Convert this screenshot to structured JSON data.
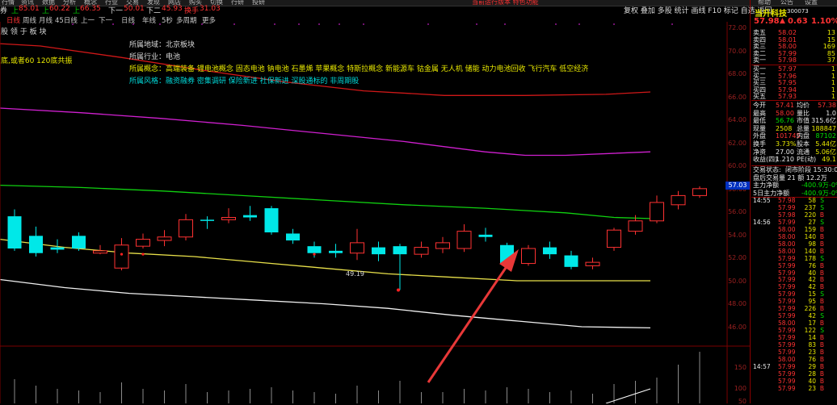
{
  "menubar": {
    "items": [
      "行情",
      "资讯",
      "数据",
      "分析",
      "概念",
      "行业",
      "交易",
      "发现",
      "网店",
      "购买",
      "切换",
      "行研",
      "投研"
    ],
    "right_items": [
      "帮助",
      "公告",
      "设置"
    ],
    "center_note": "当前运行版本 特色功能"
  },
  "toolbar": {
    "left_fragment": "券",
    "label_a": "上",
    "value_a": "85.01",
    "label_b": "上",
    "value_b": "60.22",
    "label_c": "上",
    "value_c": "66.35",
    "label_d": "下一",
    "value_d": "50.01",
    "label_e": "下二",
    "value_e": "45.93",
    "label_f": "换手",
    "value_f": "31.03",
    "right_tools": "复权 叠加 多股 统计 画线 F10 标记 自选 返回"
  },
  "period_bar": {
    "items": [
      "日线",
      "周线",
      "月线",
      "45日线",
      "上一",
      "下一",
      "日线",
      "年线",
      "5秒",
      "多周期",
      "更多"
    ],
    "active_index": 0
  },
  "info": {
    "board_label": "股 领 于 板 块",
    "indicator_label": "底,或者60 120底共振",
    "region": "所属地域：北京板块",
    "industry": "所属行业：电池",
    "concepts": "所属概念：高端装备 锂电池概念 固态电池 钠电池 石墨烯 苹果概念 特斯拉概念 新能源车 钴金属 无人机 储能 动力电池回收 飞行汽车 低空经济",
    "styles": "所属风格：融资融券 密集调研 保险新进 社保新进 深股通标的 非周期股"
  },
  "price_axis": {
    "labels": [
      "72.00",
      "70.00",
      "68.00",
      "66.00",
      "64.00",
      "62.00",
      "60.00",
      "58.00",
      "56.00",
      "54.00",
      "52.00",
      "50.00",
      "48.00",
      "46.00"
    ],
    "current_tag": "57.03"
  },
  "volume_axis": {
    "labels": [
      "150",
      "100",
      "50"
    ]
  },
  "low_marker": "49.19",
  "stock": {
    "name": "当升科技",
    "code": "300073",
    "price": "57.98",
    "change_arrow": "▲",
    "change": "0.63",
    "change_pct": "1.10%"
  },
  "order_book": {
    "asks": [
      {
        "label": "卖五",
        "price": "58.02",
        "vol": "13"
      },
      {
        "label": "卖四",
        "price": "58.01",
        "vol": "15"
      },
      {
        "label": "卖三",
        "price": "58.00",
        "vol": "169"
      },
      {
        "label": "卖二",
        "price": "57.99",
        "vol": "85"
      },
      {
        "label": "卖一",
        "price": "57.98",
        "vol": "37"
      }
    ],
    "bids": [
      {
        "label": "买一",
        "price": "57.97",
        "vol": "1"
      },
      {
        "label": "买二",
        "price": "57.96",
        "vol": "1"
      },
      {
        "label": "买三",
        "price": "57.95",
        "vol": "1"
      },
      {
        "label": "买四",
        "price": "57.94",
        "vol": "1"
      },
      {
        "label": "买五",
        "price": "57.93",
        "vol": "1"
      }
    ]
  },
  "stats": [
    {
      "l1": "今开",
      "v1": "57.41",
      "l2": "均价",
      "v2": "57.38"
    },
    {
      "l1": "最高",
      "v1": "58.00",
      "l2": "量比",
      "v2": "1.0"
    },
    {
      "l1": "最低",
      "v1": "56.76",
      "l2": "市值",
      "v2": "315.6亿"
    },
    {
      "l1": "现量",
      "v1": "2508",
      "l2": "总量",
      "v2": "188847"
    },
    {
      "l1": "外盘",
      "v1": "101745",
      "l2": "内盘",
      "v2": "87102"
    },
    {
      "l1": "换手",
      "v1": "3.73%",
      "l2": "股本",
      "v2": "5.44亿"
    },
    {
      "l1": "净资",
      "v1": "27.00",
      "l2": "流通",
      "v2": "5.06亿"
    },
    {
      "l1": "收益(四)",
      "v1": "1.210",
      "l2": "PE(动)",
      "v2": "49.1"
    }
  ],
  "trade_status": {
    "line1_label": "交易状态:",
    "line1_value": "闭市阶段 15:30:00",
    "line2": "盘后交易量 21 额 12.2万"
  },
  "main_flow": {
    "row1_label": "主力净额",
    "row1_value": "-400.9万",
    "row1_pct": "-0%",
    "row2_label": "5日主力净额",
    "row2_value": "-400.9万",
    "row2_pct": "-0%"
  },
  "ticks": {
    "time1": "14:55",
    "time2": "14:56",
    "time3": "14:57",
    "rows": [
      {
        "p": "57.98",
        "v": "58",
        "f": "S"
      },
      {
        "p": "57.99",
        "v": "237",
        "f": "S"
      },
      {
        "p": "57.98",
        "v": "220",
        "f": "B"
      },
      {
        "p": "57.99",
        "v": "27",
        "f": "S"
      },
      {
        "p": "58.00",
        "v": "159",
        "f": "B"
      },
      {
        "p": "58.00",
        "v": "140",
        "f": "B"
      },
      {
        "p": "58.00",
        "v": "98",
        "f": "B"
      },
      {
        "p": "58.00",
        "v": "140",
        "f": "B"
      },
      {
        "p": "57.99",
        "v": "178",
        "f": "S"
      },
      {
        "p": "57.99",
        "v": "76",
        "f": "B"
      },
      {
        "p": "57.99",
        "v": "40",
        "f": "B"
      },
      {
        "p": "57.99",
        "v": "42",
        "f": "B"
      },
      {
        "p": "57.99",
        "v": "42",
        "f": "B"
      },
      {
        "p": "57.99",
        "v": "15",
        "f": "S"
      },
      {
        "p": "57.99",
        "v": "95",
        "f": "B"
      },
      {
        "p": "57.99",
        "v": "226",
        "f": "B"
      },
      {
        "p": "57.99",
        "v": "42",
        "f": "S"
      },
      {
        "p": "58.00",
        "v": "17",
        "f": "B"
      },
      {
        "p": "57.99",
        "v": "122",
        "f": "S"
      },
      {
        "p": "57.99",
        "v": "14",
        "f": "B"
      },
      {
        "p": "57.99",
        "v": "83",
        "f": "B"
      },
      {
        "p": "57.99",
        "v": "23",
        "f": "B"
      },
      {
        "p": "58.00",
        "v": "76",
        "f": "B"
      },
      {
        "p": "57.99",
        "v": "29",
        "f": "B"
      },
      {
        "p": "57.99",
        "v": "28",
        "f": "B"
      },
      {
        "p": "57.99",
        "v": "40",
        "f": "B"
      },
      {
        "p": "57.99",
        "v": "23",
        "f": "B"
      }
    ]
  },
  "colors": {
    "up": "#ff3232",
    "down": "#00e8e8",
    "ma_yellow": "#e8e04a",
    "ma_white": "#f0f0f0",
    "ma_green": "#10d010",
    "ma_magenta": "#d020d0",
    "ma_red": "#d01818",
    "arrow": "#e83838"
  },
  "candles": [
    {
      "o": 55.6,
      "c": 52.8,
      "h": 56.2,
      "l": 52.6
    },
    {
      "o": 53.9,
      "c": 52.4,
      "h": 54.7,
      "l": 52.1
    },
    {
      "o": 52.9,
      "c": 52.7,
      "h": 53.6,
      "l": 52.4
    },
    {
      "o": 53.9,
      "c": 52.8,
      "h": 54.2,
      "l": 52.6
    },
    {
      "o": 52.4,
      "c": 52.6,
      "h": 53.1,
      "l": 52.3
    },
    {
      "o": 51.1,
      "c": 53.1,
      "h": 53.7,
      "l": 50.9
    },
    {
      "o": 53.0,
      "c": 53.6,
      "h": 54.1,
      "l": 52.8
    },
    {
      "o": 53.5,
      "c": 53.8,
      "h": 54.4,
      "l": 53.0
    },
    {
      "o": 53.8,
      "c": 55.3,
      "h": 55.8,
      "l": 53.5
    },
    {
      "o": 55.3,
      "c": 55.2,
      "h": 55.6,
      "l": 54.5
    },
    {
      "o": 55.3,
      "c": 55.5,
      "h": 56.3,
      "l": 55.0
    },
    {
      "o": 55.7,
      "c": 55.5,
      "h": 56.5,
      "l": 55.2
    },
    {
      "o": 56.3,
      "c": 54.2,
      "h": 56.5,
      "l": 54.0
    },
    {
      "o": 54.1,
      "c": 53.5,
      "h": 54.5,
      "l": 53.2
    },
    {
      "o": 53.0,
      "c": 52.4,
      "h": 53.4,
      "l": 52.0
    },
    {
      "o": 52.6,
      "c": 52.4,
      "h": 53.2,
      "l": 52.0
    },
    {
      "o": 52.4,
      "c": 53.3,
      "h": 54.5,
      "l": 51.8
    },
    {
      "o": 52.9,
      "c": 52.3,
      "h": 53.4,
      "l": 51.7
    },
    {
      "o": 53.0,
      "c": 52.3,
      "h": 53.2,
      "l": 49.2
    },
    {
      "o": 52.3,
      "c": 52.9,
      "h": 53.4,
      "l": 52.0
    },
    {
      "o": 52.8,
      "c": 53.3,
      "h": 53.8,
      "l": 52.4
    },
    {
      "o": 52.8,
      "c": 54.3,
      "h": 54.9,
      "l": 52.5
    },
    {
      "o": 54.0,
      "c": 53.8,
      "h": 54.6,
      "l": 53.4
    },
    {
      "o": 53.1,
      "c": 51.5,
      "h": 53.3,
      "l": 51.3
    },
    {
      "o": 51.5,
      "c": 52.8,
      "h": 53.1,
      "l": 51.3
    },
    {
      "o": 52.9,
      "c": 52.3,
      "h": 53.4,
      "l": 51.9
    },
    {
      "o": 52.2,
      "c": 51.2,
      "h": 52.6,
      "l": 51.0
    },
    {
      "o": 51.3,
      "c": 51.6,
      "h": 52.0,
      "l": 51.0
    },
    {
      "o": 52.9,
      "c": 54.4,
      "h": 54.6,
      "l": 52.6
    },
    {
      "o": 54.3,
      "c": 55.2,
      "h": 55.7,
      "l": 54.0
    },
    {
      "o": 55.2,
      "c": 56.8,
      "h": 57.4,
      "l": 55.0
    },
    {
      "o": 56.6,
      "c": 57.4,
      "h": 57.8,
      "l": 56.2
    },
    {
      "o": 57.4,
      "c": 58.0,
      "h": 58.2,
      "l": 57.2
    }
  ],
  "volumes": [
    30,
    22,
    18,
    16,
    14,
    26,
    18,
    16,
    24,
    14,
    16,
    18,
    20,
    16,
    14,
    12,
    22,
    16,
    28,
    14,
    14,
    18,
    16,
    20,
    18,
    14,
    16,
    12,
    24,
    28,
    32,
    48,
    64
  ],
  "ma_lines": {
    "red": [
      [
        0,
        70.6
      ],
      [
        50,
        70.4
      ],
      [
        150,
        69.4
      ],
      [
        250,
        68.3
      ],
      [
        350,
        67.3
      ],
      [
        450,
        66.5
      ],
      [
        550,
        66.1
      ],
      [
        650,
        66.1
      ],
      [
        750,
        66.2
      ],
      [
        805,
        66.4
      ]
    ],
    "magenta": [
      [
        0,
        65.0
      ],
      [
        100,
        64.6
      ],
      [
        200,
        64.1
      ],
      [
        300,
        63.5
      ],
      [
        400,
        62.8
      ],
      [
        500,
        62.1
      ],
      [
        600,
        61.2
      ],
      [
        650,
        60.9
      ],
      [
        700,
        60.9
      ],
      [
        805,
        61.2
      ]
    ],
    "green": [
      [
        0,
        58.3
      ],
      [
        100,
        58.1
      ],
      [
        200,
        57.8
      ],
      [
        300,
        57.4
      ],
      [
        400,
        57.0
      ],
      [
        500,
        56.6
      ],
      [
        600,
        56.3
      ],
      [
        700,
        55.9
      ],
      [
        760,
        55.5
      ],
      [
        805,
        55.4
      ]
    ],
    "yellow": [
      [
        0,
        53.6
      ],
      [
        80,
        52.9
      ],
      [
        160,
        52.4
      ],
      [
        240,
        52.1
      ],
      [
        320,
        51.6
      ],
      [
        400,
        51.1
      ],
      [
        480,
        50.6
      ],
      [
        560,
        50.3
      ],
      [
        640,
        50.0
      ],
      [
        720,
        50.0
      ],
      [
        805,
        50.0
      ]
    ],
    "white": [
      [
        0,
        50.1
      ],
      [
        80,
        49.4
      ],
      [
        160,
        48.9
      ],
      [
        240,
        48.6
      ],
      [
        320,
        48.3
      ],
      [
        400,
        48.0
      ],
      [
        480,
        47.6
      ],
      [
        560,
        47.0
      ],
      [
        640,
        46.5
      ],
      [
        720,
        46.0
      ],
      [
        805,
        45.9
      ]
    ]
  }
}
